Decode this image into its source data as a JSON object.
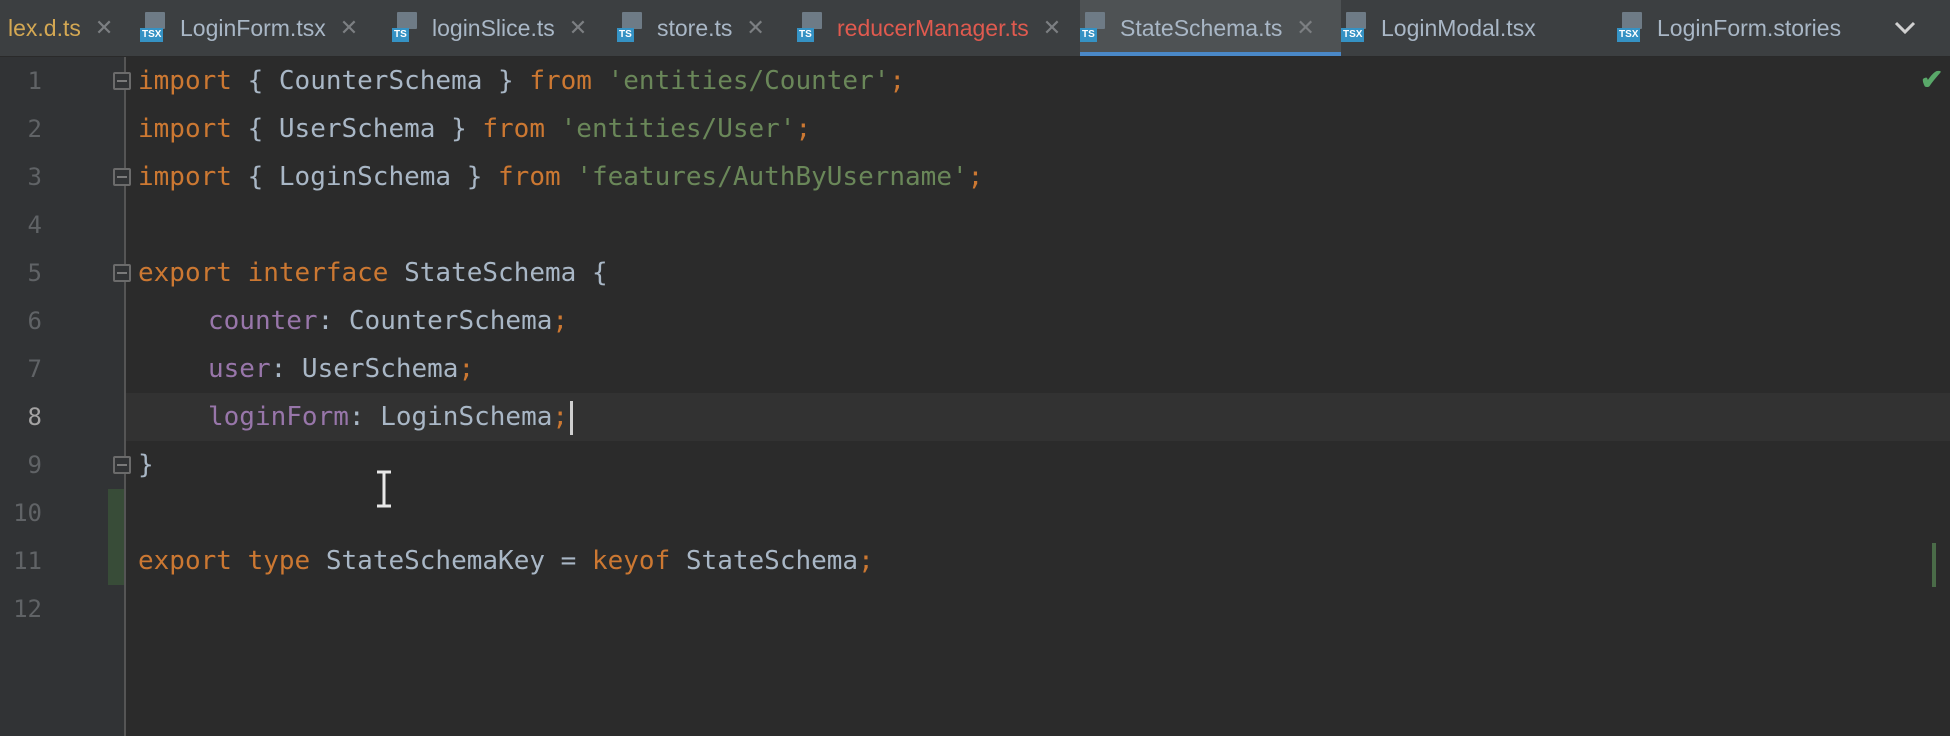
{
  "tabs": [
    {
      "label": "lex.d.ts",
      "badge": "",
      "style": "warn",
      "closable": true
    },
    {
      "label": "LoginForm.tsx",
      "badge": "TSX",
      "style": "normal",
      "closable": true
    },
    {
      "label": "loginSlice.ts",
      "badge": "TS",
      "style": "normal",
      "closable": true
    },
    {
      "label": "store.ts",
      "badge": "TS",
      "style": "normal",
      "closable": true
    },
    {
      "label": "reducerManager.ts",
      "badge": "TS",
      "style": "err",
      "closable": true
    },
    {
      "label": "StateSchema.ts",
      "badge": "TS",
      "style": "active",
      "closable": true
    },
    {
      "label": "LoginModal.tsx",
      "badge": "TSX",
      "style": "normal",
      "closable": false
    },
    {
      "label": "LoginForm.stories",
      "badge": "TSX",
      "style": "normal",
      "closable": false
    }
  ],
  "tab_close_glyph": "✕",
  "tab_overflow_icon": "chevron-down-icon",
  "editor": {
    "current_line": 8,
    "lines": [
      {
        "n": "1",
        "tokens": [
          [
            "kw",
            "import"
          ],
          [
            "p",
            " { CounterSchema } "
          ],
          [
            "kw",
            "from"
          ],
          [
            "p",
            " "
          ],
          [
            "str",
            "'entities/Counter'"
          ],
          [
            "kw",
            ";"
          ]
        ]
      },
      {
        "n": "2",
        "tokens": [
          [
            "kw",
            "import"
          ],
          [
            "p",
            " { UserSchema } "
          ],
          [
            "kw",
            "from"
          ],
          [
            "p",
            " "
          ],
          [
            "str",
            "'entities/User'"
          ],
          [
            "kw",
            ";"
          ]
        ]
      },
      {
        "n": "3",
        "tokens": [
          [
            "kw",
            "import"
          ],
          [
            "p",
            " { LoginSchema } "
          ],
          [
            "kw",
            "from"
          ],
          [
            "p",
            " "
          ],
          [
            "str",
            "'features/AuthByUsername'"
          ],
          [
            "kw",
            ";"
          ]
        ]
      },
      {
        "n": "4",
        "tokens": []
      },
      {
        "n": "5",
        "tokens": [
          [
            "kw",
            "export"
          ],
          [
            "p",
            " "
          ],
          [
            "kw",
            "interface"
          ],
          [
            "p",
            " StateSchema {"
          ]
        ]
      },
      {
        "n": "6",
        "indent": true,
        "tokens": [
          [
            "prop",
            "counter"
          ],
          [
            "p",
            ": CounterSchema"
          ],
          [
            "kw",
            ";"
          ]
        ]
      },
      {
        "n": "7",
        "indent": true,
        "tokens": [
          [
            "prop",
            "user"
          ],
          [
            "p",
            ": UserSchema"
          ],
          [
            "kw",
            ";"
          ]
        ]
      },
      {
        "n": "8",
        "indent": true,
        "tokens": [
          [
            "prop",
            "loginForm"
          ],
          [
            "p",
            ": LoginSchema"
          ],
          [
            "kw",
            ";"
          ]
        ]
      },
      {
        "n": "9",
        "tokens": [
          [
            "p",
            "}"
          ]
        ]
      },
      {
        "n": "10",
        "tokens": []
      },
      {
        "n": "11",
        "tokens": [
          [
            "kw",
            "export"
          ],
          [
            "p",
            " "
          ],
          [
            "kw",
            "type"
          ],
          [
            "p",
            " StateSchemaKey = "
          ],
          [
            "kw",
            "keyof"
          ],
          [
            "p",
            " StateSchema"
          ],
          [
            "kw",
            ";"
          ]
        ]
      },
      {
        "n": "12",
        "tokens": []
      }
    ]
  },
  "inspection_status_icon": "checkmark-icon",
  "colors": {
    "keyword": "#cc7832",
    "string": "#6a8759",
    "property": "#9876aa",
    "text": "#a9b7c6",
    "active_tab_underline": "#4a88c7"
  }
}
